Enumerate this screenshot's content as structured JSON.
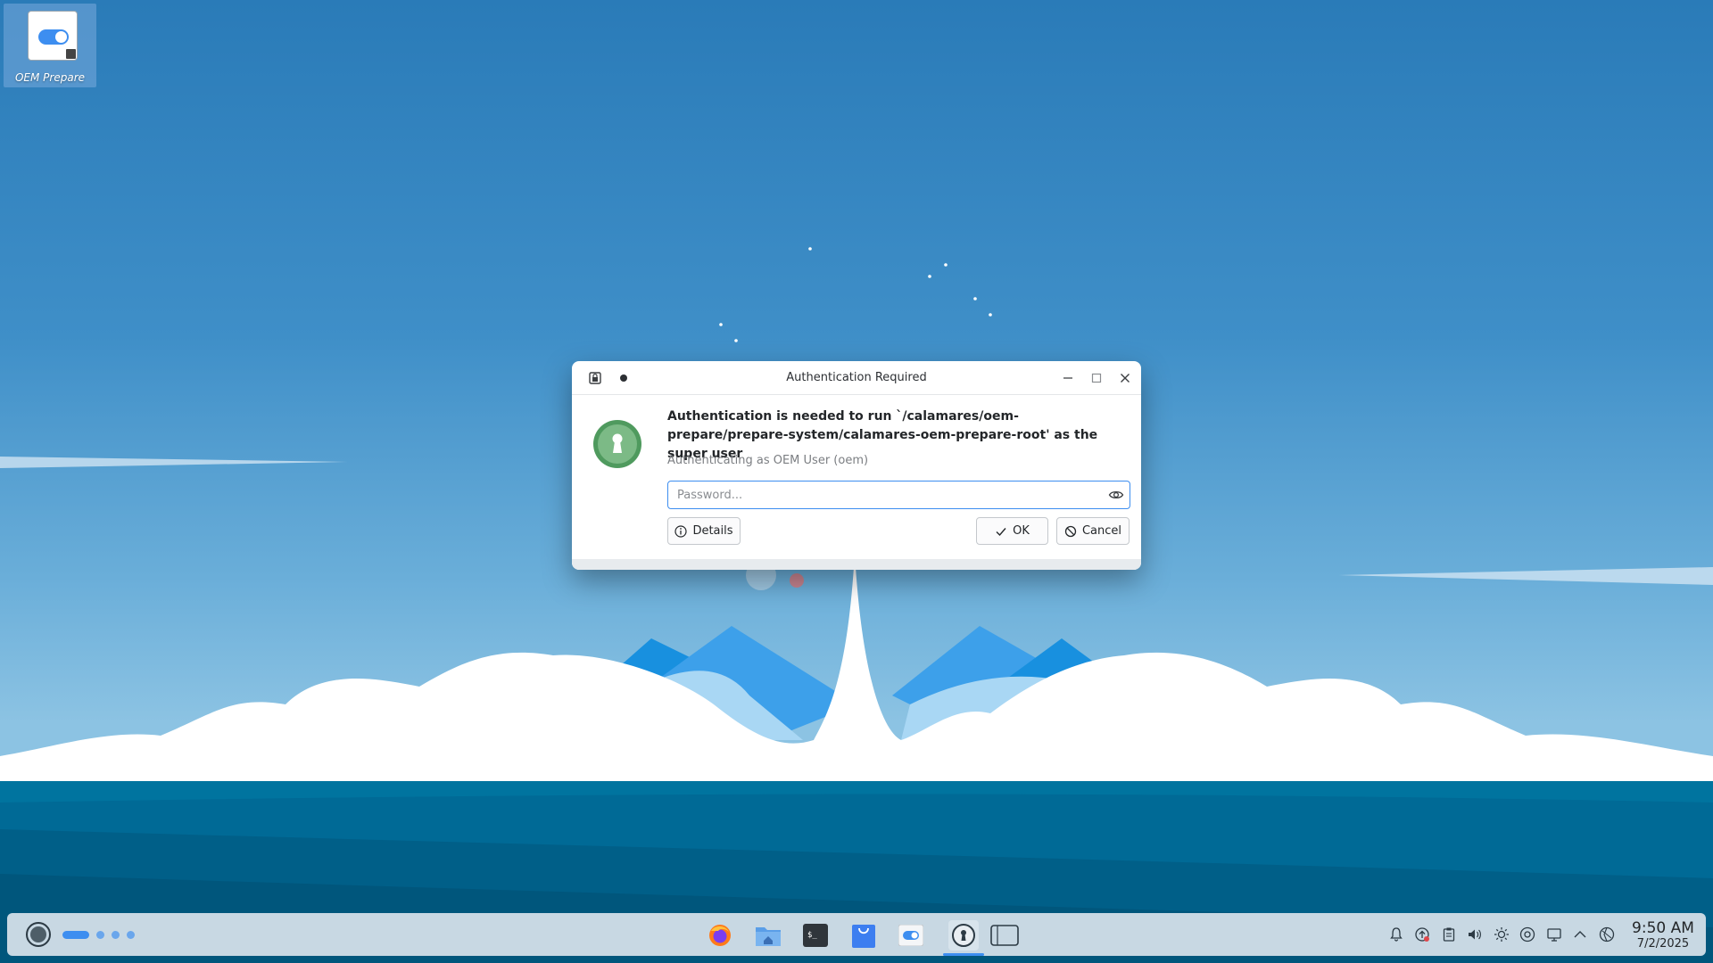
{
  "desktop": {
    "icons": [
      {
        "label": "OEM Prepare"
      }
    ]
  },
  "dialog": {
    "title": "Authentication Required",
    "headline": "Authentication is needed to run `/calamares/oem-prepare/prepare-system/calamares-oem-prepare-root' as the super user",
    "subline": "Authenticating as OEM User (oem)",
    "password_placeholder": "Password...",
    "password_value": "",
    "details_label": "Details",
    "ok_label": "OK",
    "cancel_label": "Cancel",
    "icons": {
      "window": "lock-icon",
      "keep_above": "pin-dot-icon",
      "minimize": "minimize-icon",
      "maximize": "maximize-icon",
      "close": "close-icon",
      "emblem": "keyhole-icon",
      "reveal": "eye-icon",
      "details": "info-icon",
      "ok": "checkmark-icon",
      "cancel": "cancel-icon"
    }
  },
  "taskbar": {
    "apps": [
      "firefox",
      "file-manager",
      "terminal",
      "discover-store",
      "oem-prepare",
      "authentication",
      "window"
    ],
    "tray": [
      "notifications",
      "updates",
      "clipboard",
      "volume",
      "brightness",
      "media",
      "display",
      "expand",
      "network"
    ],
    "clock": {
      "time": "9:50 AM",
      "date": "7/2/2025"
    }
  },
  "colors": {
    "accent": "#3d8ef0",
    "emblem_green": "#6db07a",
    "taskbar": "#c8d8e3",
    "sea_dark": "#006a96"
  }
}
